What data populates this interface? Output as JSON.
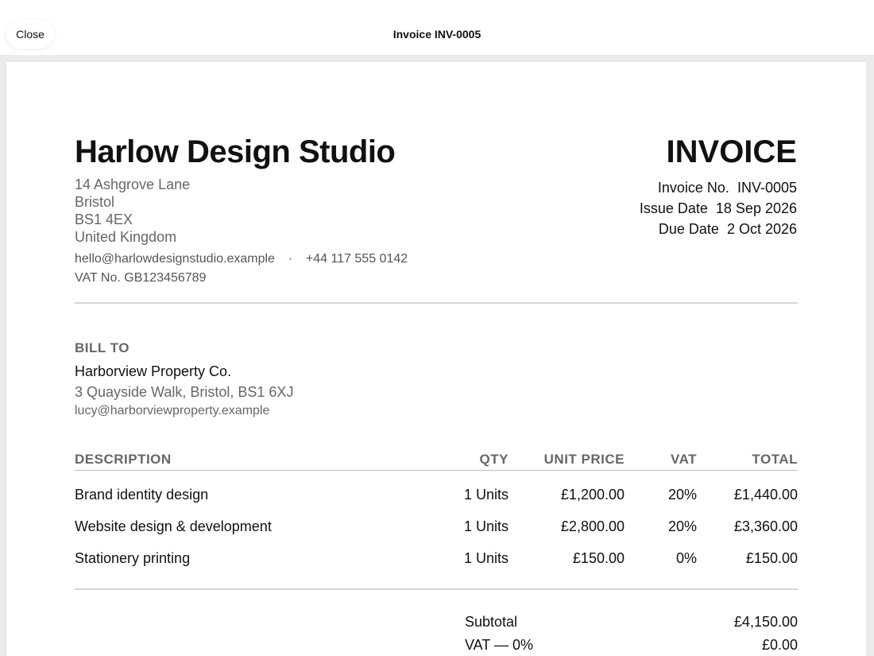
{
  "window": {
    "close_label": "Close",
    "title": "Invoice INV-0005"
  },
  "company": {
    "name": "Harlow Design Studio",
    "address": [
      "14 Ashgrove Lane",
      "Bristol",
      "BS1 4EX",
      "United Kingdom"
    ],
    "email": "hello@harlowdesignstudio.example",
    "separator": "·",
    "phone": "+44 117 555 0142",
    "vat_no": "VAT No. GB123456789"
  },
  "invoice": {
    "heading": "INVOICE",
    "number_label": "Invoice No.",
    "number": "INV-0005",
    "issue_label": "Issue Date",
    "issue_date": "18 Sep 2026",
    "due_label": "Due Date",
    "due_date": "2 Oct 2026"
  },
  "bill_to": {
    "label": "BILL TO",
    "name": "Harborview Property Co.",
    "address": "3 Quayside Walk, Bristol, BS1 6XJ",
    "email": "lucy@harborviewproperty.example"
  },
  "table": {
    "headers": {
      "description": "DESCRIPTION",
      "qty": "QTY",
      "unit_price": "UNIT PRICE",
      "vat": "VAT",
      "total": "TOTAL"
    },
    "rows": [
      {
        "description": "Brand identity design",
        "qty": "1 Units",
        "unit_price": "£1,200.00",
        "vat": "20%",
        "total": "£1,440.00"
      },
      {
        "description": "Website design & development",
        "qty": "1 Units",
        "unit_price": "£2,800.00",
        "vat": "20%",
        "total": "£3,360.00"
      },
      {
        "description": "Stationery printing",
        "qty": "1 Units",
        "unit_price": "£150.00",
        "vat": "0%",
        "total": "£150.00"
      }
    ]
  },
  "totals": {
    "subtotal_label": "Subtotal",
    "subtotal_value": "£4,150.00",
    "vat0_label": "VAT — 0%",
    "vat0_value": "£0.00"
  }
}
